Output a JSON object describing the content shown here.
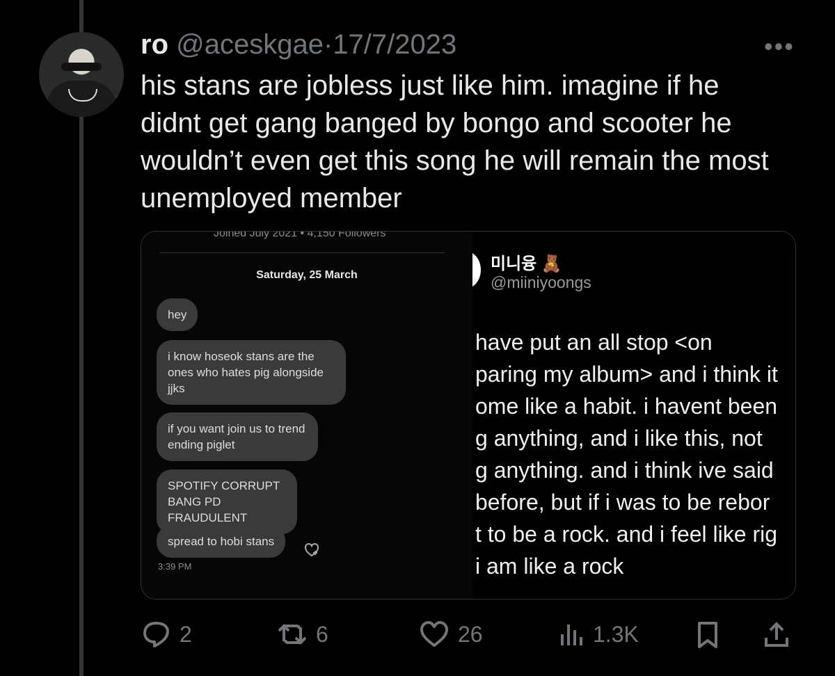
{
  "tweet": {
    "author_name": "ro",
    "handle": "@aceskgae",
    "separator": "·",
    "date": "17/7/2023",
    "more": "•••",
    "text": "his stans are jobless just like him. imagine if he didnt get gang banged by bongo and scooter he wouldn’t even get this song he will remain the most unemployed member"
  },
  "media": {
    "left": {
      "cut_header": "Joined July 2021 • 4,150 Followers",
      "date": "Saturday, 25 March",
      "messages": [
        "hey",
        "i know hoseok stans are the ones who hates pig alongside jjks",
        "if you want join us to trend ending piglet",
        "SPOTIFY CORRUPT BANG PD FRAUDULENT",
        "spread to hobi stans"
      ],
      "time": "3:39 PM"
    },
    "right": {
      "name": "미니융 🧸",
      "handle": "@miiniyoongs",
      "lines": [
        "have put an all stop <on",
        "paring my album> and i think it",
        "ome like a habit. i havent been",
        "g anything, and i like this, not",
        "g anything. and i think ive said",
        "before, but if i was to be rebor",
        "t to be a rock. and i feel like rig",
        "i am like a rock"
      ]
    }
  },
  "actions": {
    "replies": "2",
    "reposts": "6",
    "likes": "26",
    "views": "1.3K"
  },
  "colors": {
    "background": "#000000",
    "text": "#e7e9ea",
    "muted": "#71767b",
    "bubble": "#3a3a3a"
  },
  "icons": [
    "reply-icon",
    "repost-icon",
    "like-icon",
    "views-icon",
    "bookmark-icon",
    "share-icon"
  ]
}
